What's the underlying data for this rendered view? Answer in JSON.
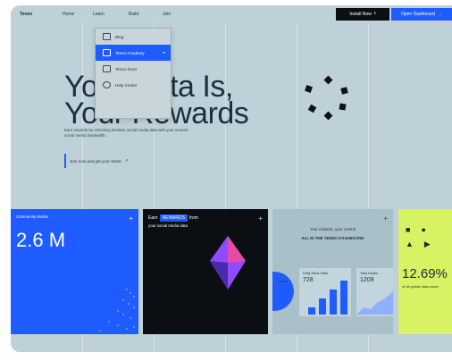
{
  "topbar": {
    "logo": "Teneo",
    "nav": [
      "Home",
      "Learn",
      "Build",
      "Join"
    ],
    "install_label": "Install Now",
    "dashboard_label": "Open Dashboard"
  },
  "dropdown": {
    "items": [
      {
        "label": "Blog",
        "active": false
      },
      {
        "label": "Teneo Academy",
        "active": true
      },
      {
        "label": "Teneo Docs",
        "active": false
      },
      {
        "label": "Help Center",
        "active": false
      }
    ]
  },
  "hero": {
    "title_line1": "Your Data Is,",
    "title_line2": "Your Rewards",
    "subtitle": "Earn rewards by unlocking limitless social media data with your unused social media bandwidth.",
    "cta_label": "Join now and get your share"
  },
  "cards": {
    "community": {
      "label": "Community Nodes",
      "value": "2.6 M"
    },
    "earn": {
      "prefix": "Earn",
      "badge": "REWARDS",
      "suffix": "from",
      "line2": "your social media data"
    },
    "dashboard": {
      "title": "Your rewards, your control",
      "subtitle": "ALL IN THE TENEO DASHBOARD",
      "stat1_label": "Daily Rank Stats",
      "stat1_value": "728",
      "stat2_label": "Total Nodes",
      "stat2_value": "1209",
      "pie_label": "Nodes"
    },
    "global": {
      "value": "12.69%",
      "label": "of all global data power"
    }
  },
  "colors": {
    "accent": "#1e5cff",
    "background": "#bfd1d8",
    "lime": "#d7f263",
    "dark": "#0b0f14"
  }
}
